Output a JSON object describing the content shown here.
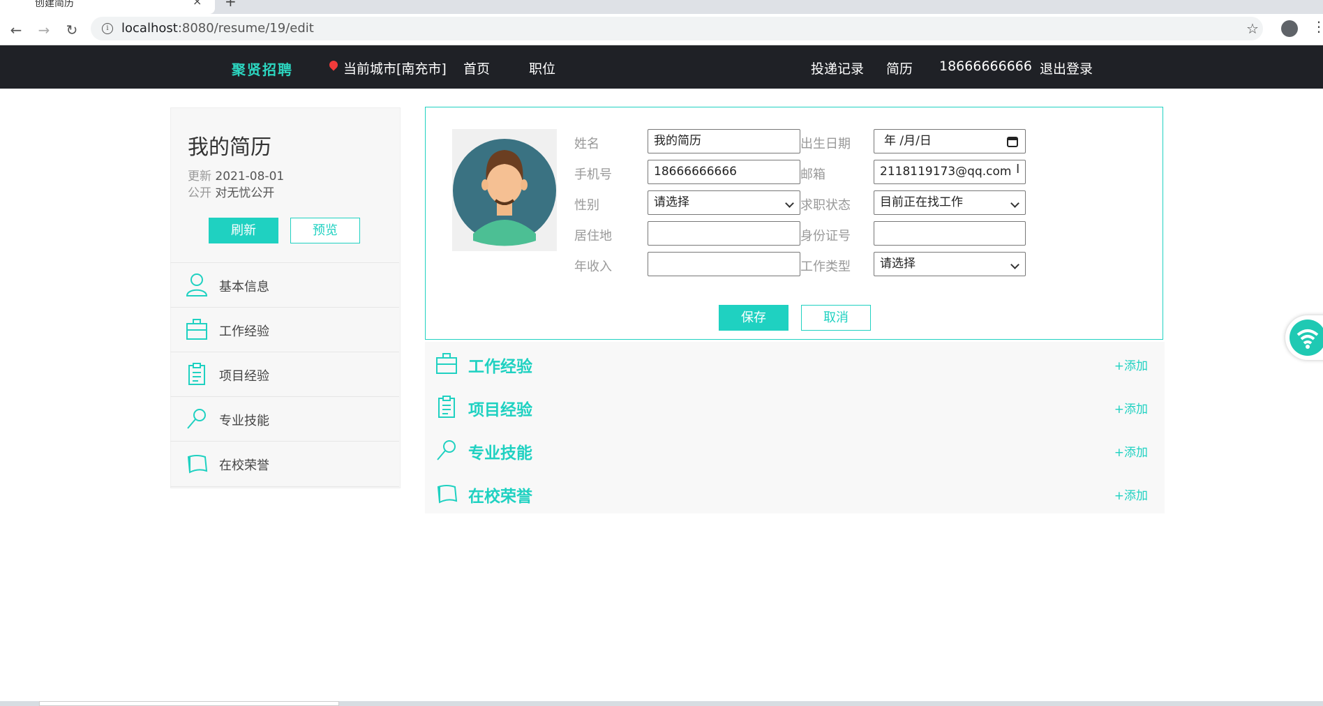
{
  "browser": {
    "tab_title": "创建简历",
    "url_host": "localhost",
    "url_path": ":8080/resume/19/edit",
    "nav": {
      "back": "←",
      "forward": "→",
      "reload": "↻"
    }
  },
  "site": {
    "logo": "聚贤招聘",
    "city": "当前城市[南充市]",
    "nav_left": [
      "首页",
      "职位"
    ],
    "nav_right": [
      "投递记录",
      "简历",
      "18666666666",
      "退出登录"
    ]
  },
  "sidebar": {
    "title": "我的简历",
    "updated_label": "更新",
    "updated_value": "2021-08-01",
    "public_label": "公开",
    "public_value": "对无忧公开",
    "refresh_btn": "刷新",
    "preview_btn": "预览",
    "items": [
      {
        "label": "基本信息",
        "icon": "person-icon"
      },
      {
        "label": "工作经验",
        "icon": "briefcase-icon"
      },
      {
        "label": "项目经验",
        "icon": "clipboard-icon"
      },
      {
        "label": "专业技能",
        "icon": "magnifier-icon"
      },
      {
        "label": "在校荣誉",
        "icon": "scroll-icon"
      }
    ]
  },
  "form": {
    "name_label": "姓名",
    "name_value": "我的简历",
    "birth_label": "出生日期",
    "birth_value": "年 /月/日",
    "phone_label": "手机号",
    "phone_value": "18666666666",
    "email_label": "邮箱",
    "email_value": "2118119173@qq.com",
    "gender_label": "性别",
    "gender_value": "请选择",
    "status_label": "求职状态",
    "status_value": "目前正在找工作",
    "residence_label": "居住地",
    "residence_value": "",
    "idcard_label": "身份证号",
    "idcard_value": "",
    "income_label": "年收入",
    "income_value": "",
    "jobtype_label": "工作类型",
    "jobtype_value": "请选择",
    "save_btn": "保存",
    "cancel_btn": "取消"
  },
  "sections": [
    {
      "title": "工作经验",
      "add": "+添加",
      "icon": "briefcase-icon"
    },
    {
      "title": "项目经验",
      "add": "+添加",
      "icon": "clipboard-icon"
    },
    {
      "title": "专业技能",
      "add": "+添加",
      "icon": "magnifier-icon"
    },
    {
      "title": "在校荣誉",
      "add": "+添加",
      "icon": "scroll-icon"
    }
  ],
  "colors": {
    "accent": "#1fd1c1",
    "nav_bg": "#1f2126"
  }
}
